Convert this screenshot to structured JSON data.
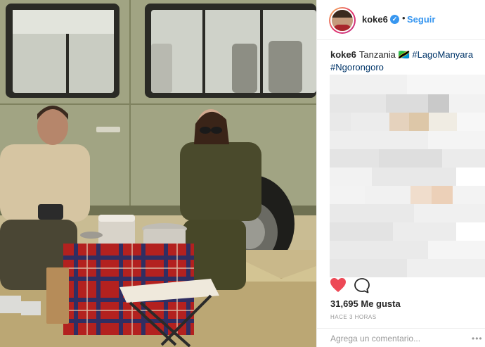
{
  "post": {
    "header": {
      "username": "koke6",
      "verified_icon": "verified-badge-icon",
      "separator": "•",
      "follow_label": "Seguir"
    },
    "caption": {
      "username": "koke6",
      "text": "Tanzania",
      "emoji_text": "🇹🇿",
      "hashtags": [
        "#LagoManyara",
        "#Ngorongoro"
      ]
    },
    "comments_area": "pixelated / blurred",
    "actions": {
      "like_icon": "heart-icon",
      "like_color": "#ed4956",
      "comment_icon": "comment-icon"
    },
    "likes_text": "31,695 Me gusta",
    "timestamp": "HACE 3 HORAS",
    "comment_input": {
      "placeholder": "Agrega un comentario..."
    },
    "more_icon": "more-options-icon"
  },
  "colors": {
    "accent": "#3897f0",
    "hashtag": "#003569",
    "secondary_text": "#999999",
    "border": "#efefef"
  }
}
